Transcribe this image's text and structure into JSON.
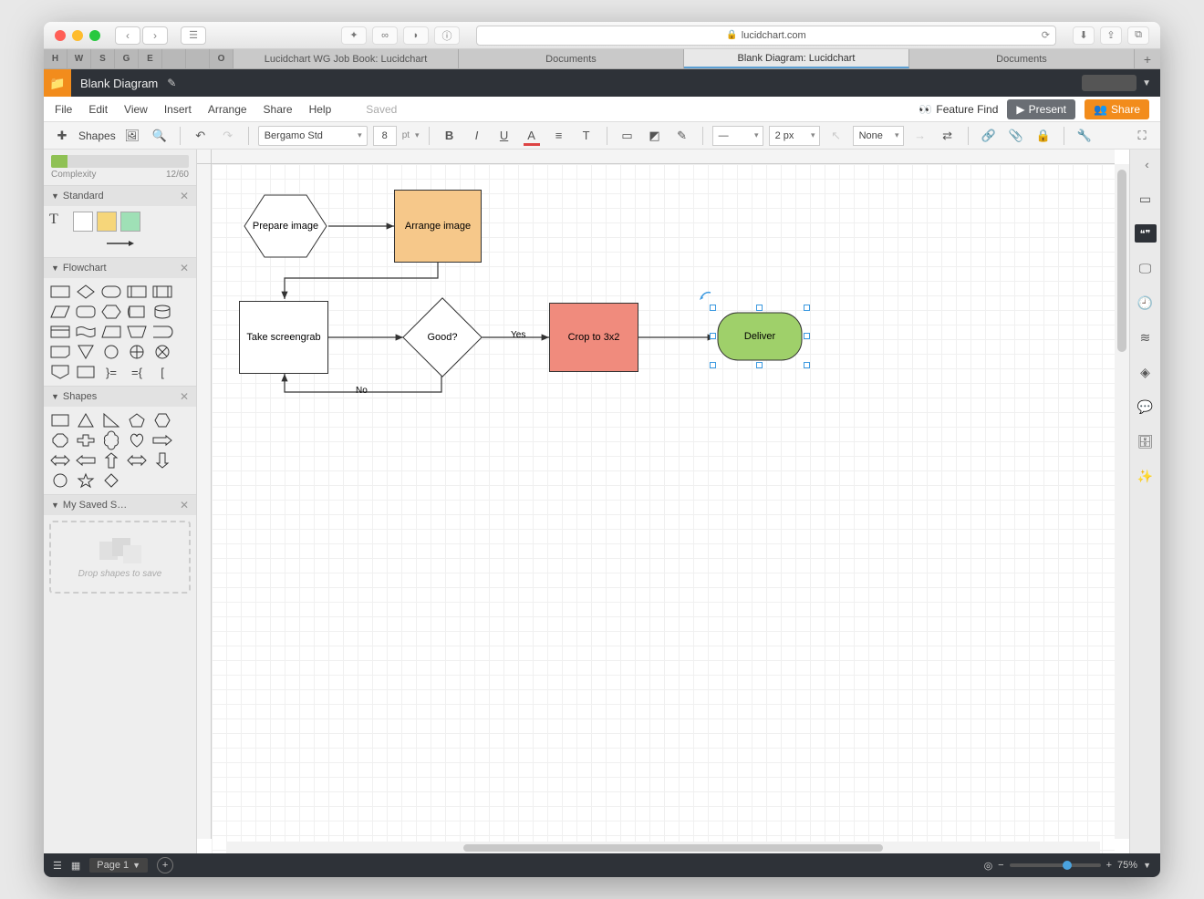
{
  "browser": {
    "url": "lucidchart.com",
    "pinned": [
      "H",
      "W",
      "S",
      "G",
      "E"
    ],
    "tabs": [
      "Lucidchart WG Job Book: Lucidchart",
      "Documents",
      "Blank Diagram: Lucidchart",
      "Documents"
    ],
    "active_tab_index": 2
  },
  "header": {
    "doc_name": "Blank Diagram"
  },
  "menu": {
    "items": [
      "File",
      "Edit",
      "View",
      "Insert",
      "Arrange",
      "Share",
      "Help"
    ],
    "status": "Saved",
    "feature_find": "Feature Find",
    "present": "Present",
    "share": "Share"
  },
  "toolbar": {
    "shapes_label": "Shapes",
    "font": "Bergamo Std",
    "font_size": "8",
    "font_unit": "pt",
    "line_width": "2 px",
    "arrow_end": "None"
  },
  "left": {
    "complexity_label": "Complexity",
    "complexity_value": "12/60",
    "sections": {
      "standard": "Standard",
      "flowchart": "Flowchart",
      "shapes": "Shapes",
      "saved": "My Saved S…"
    },
    "dropzone": "Drop shapes to save"
  },
  "diagram": {
    "nodes": {
      "prepare": "Prepare image",
      "arrange": "Arrange image",
      "screengrab": "Take screengrab",
      "good": "Good?",
      "crop": "Crop to 3x2",
      "deliver": "Deliver"
    },
    "edge_labels": {
      "yes": "Yes",
      "no": "No"
    }
  },
  "footer": {
    "page": "Page 1",
    "zoom": "75%"
  }
}
